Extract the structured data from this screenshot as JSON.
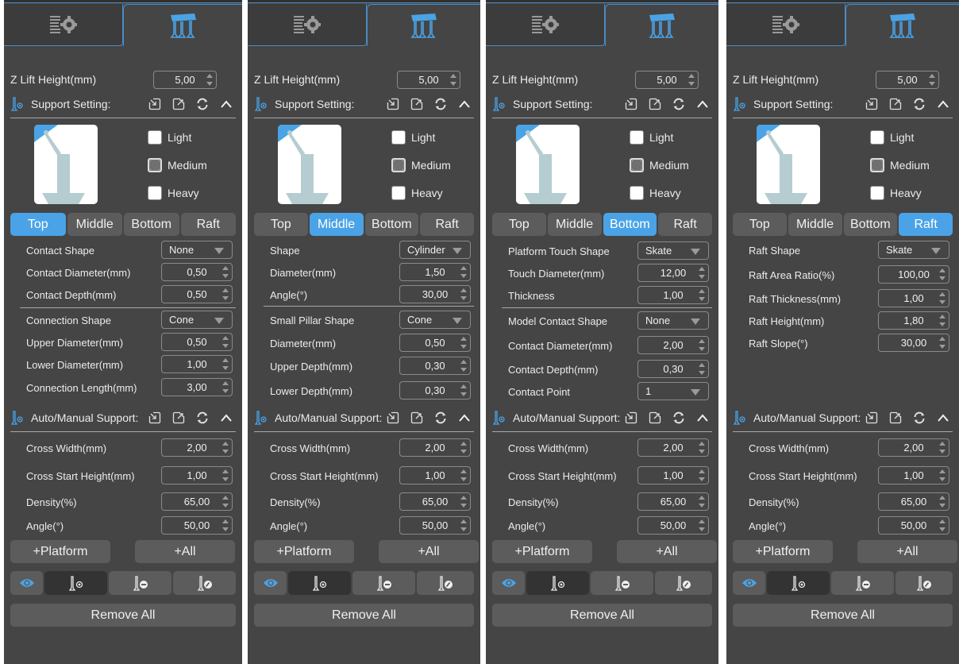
{
  "colors": {
    "accent": "#4aa3e6",
    "panel_bg": "#454545",
    "button_bg": "#5c5c5c",
    "active_tool_bg": "#333333"
  },
  "panels": [
    {
      "z_lift": {
        "label": "Z Lift Height(mm)",
        "value": "5,00"
      },
      "support_setting": {
        "title": "Support Setting:"
      },
      "density": {
        "options": [
          "Light",
          "Medium",
          "Heavy"
        ],
        "selected": "Medium"
      },
      "tabs": [
        "Top",
        "Middle",
        "Bottom",
        "Raft"
      ],
      "active_tab": "Top",
      "group1": [
        {
          "label": "Contact Shape",
          "type": "select",
          "value": "None"
        },
        {
          "label": "Contact Diameter(mm)",
          "type": "spin",
          "value": "0,50"
        },
        {
          "label": "Contact Depth(mm)",
          "type": "spin",
          "value": "0,50"
        }
      ],
      "group2": [
        {
          "label": "Connection Shape",
          "type": "select",
          "value": "Cone"
        },
        {
          "label": "Upper Diameter(mm)",
          "type": "spin",
          "value": "0,50"
        },
        {
          "label": "Lower Diameter(mm)",
          "type": "spin",
          "value": "1,00"
        },
        {
          "label": "Connection Length(mm)",
          "type": "spin",
          "value": "3,00"
        }
      ],
      "auto_manual": {
        "title": "Auto/Manual Support:",
        "fields": [
          {
            "label": "Cross Width(mm)",
            "value": "2,00"
          },
          {
            "label": "Cross Start Height(mm)",
            "value": "1,00"
          },
          {
            "label": "Density(%)",
            "value": "65,00"
          },
          {
            "label": "Angle(°)",
            "value": "50,00"
          }
        ]
      },
      "buttons": {
        "platform": "+Platform",
        "all": "+All",
        "remove_all": "Remove All"
      }
    },
    {
      "z_lift": {
        "label": "Z Lift Height(mm)",
        "value": "5,00"
      },
      "support_setting": {
        "title": "Support Setting:"
      },
      "density": {
        "options": [
          "Light",
          "Medium",
          "Heavy"
        ],
        "selected": "Medium"
      },
      "tabs": [
        "Top",
        "Middle",
        "Bottom",
        "Raft"
      ],
      "active_tab": "Middle",
      "group1": [
        {
          "label": "Shape",
          "type": "select",
          "value": "Cylinder"
        },
        {
          "label": "Diameter(mm)",
          "type": "spin",
          "value": "1,50"
        },
        {
          "label": "Angle(°)",
          "type": "spin",
          "value": "30,00"
        }
      ],
      "group2": [
        {
          "label": "Small Pillar Shape",
          "type": "select",
          "value": "Cone"
        },
        {
          "label": "Diameter(mm)",
          "type": "spin",
          "value": "0,50"
        },
        {
          "label": "Upper Depth(mm)",
          "type": "spin",
          "value": "0,30"
        },
        {
          "label": "Lower Depth(mm)",
          "type": "spin",
          "value": "0,30"
        }
      ],
      "auto_manual": {
        "title": "Auto/Manual Support:",
        "fields": [
          {
            "label": "Cross Width(mm)",
            "value": "2,00"
          },
          {
            "label": "Cross Start Height(mm)",
            "value": "1,00"
          },
          {
            "label": "Density(%)",
            "value": "65,00"
          },
          {
            "label": "Angle(°)",
            "value": "50,00"
          }
        ]
      },
      "buttons": {
        "platform": "+Platform",
        "all": "+All",
        "remove_all": "Remove All"
      }
    },
    {
      "z_lift": {
        "label": "Z Lift Height(mm)",
        "value": "5,00"
      },
      "support_setting": {
        "title": "Support Setting:"
      },
      "density": {
        "options": [
          "Light",
          "Medium",
          "Heavy"
        ],
        "selected": "Medium"
      },
      "tabs": [
        "Top",
        "Middle",
        "Bottom",
        "Raft"
      ],
      "active_tab": "Bottom",
      "group1": [
        {
          "label": "Platform Touch Shape",
          "type": "select",
          "value": "Skate"
        },
        {
          "label": "Touch Diameter(mm)",
          "type": "spin",
          "value": "12,00"
        },
        {
          "label": "Thickness",
          "type": "spin",
          "value": "1,00"
        }
      ],
      "group2": [
        {
          "label": "Model Contact Shape",
          "type": "select",
          "value": "None"
        },
        {
          "label": "Contact Diameter(mm)",
          "type": "spin",
          "value": "2,00"
        },
        {
          "label": "Contact Depth(mm)",
          "type": "spin",
          "value": "0,30"
        },
        {
          "label": "Contact Point",
          "type": "select",
          "value": "1"
        }
      ],
      "auto_manual": {
        "title": "Auto/Manual Support:",
        "fields": [
          {
            "label": "Cross Width(mm)",
            "value": "2,00"
          },
          {
            "label": "Cross Start Height(mm)",
            "value": "1,00"
          },
          {
            "label": "Density(%)",
            "value": "65,00"
          },
          {
            "label": "Angle(°)",
            "value": "50,00"
          }
        ]
      },
      "buttons": {
        "platform": "+Platform",
        "all": "+All",
        "remove_all": "Remove All"
      }
    },
    {
      "z_lift": {
        "label": "Z Lift Height(mm)",
        "value": "5,00"
      },
      "support_setting": {
        "title": "Support Setting:"
      },
      "density": {
        "options": [
          "Light",
          "Medium",
          "Heavy"
        ],
        "selected": "Medium"
      },
      "tabs": [
        "Top",
        "Middle",
        "Bottom",
        "Raft"
      ],
      "active_tab": "Raft",
      "group1": [
        {
          "label": "Raft Shape",
          "type": "select",
          "value": "Skate"
        },
        {
          "label": "Raft Area Ratio(%)",
          "type": "spin",
          "value": "100,00"
        },
        {
          "label": "Raft Thickness(mm)",
          "type": "spin",
          "value": "1,00"
        },
        {
          "label": "Raft Height(mm)",
          "type": "spin",
          "value": "1,80"
        },
        {
          "label": "Raft Slope(°)",
          "type": "spin",
          "value": "30,00"
        }
      ],
      "group2": [],
      "auto_manual": {
        "title": "Auto/Manual Support:",
        "fields": [
          {
            "label": "Cross Width(mm)",
            "value": "2,00"
          },
          {
            "label": "Cross Start Height(mm)",
            "value": "1,00"
          },
          {
            "label": "Density(%)",
            "value": "65,00"
          },
          {
            "label": "Angle(°)",
            "value": "50,00"
          }
        ]
      },
      "buttons": {
        "platform": "+Platform",
        "all": "+All",
        "remove_all": "Remove All"
      }
    }
  ],
  "icons": {
    "settings_tab": "settings-list-gear-icon",
    "support_tab": "support-table-icon",
    "section": "support-pin-icon",
    "import": "import-icon",
    "export": "export-icon",
    "reset": "refresh-icon",
    "collapse": "chevron-up-icon",
    "view": "eye-icon",
    "add_support": "add-support-icon",
    "remove_support": "remove-support-icon",
    "edit_support": "edit-support-icon"
  }
}
